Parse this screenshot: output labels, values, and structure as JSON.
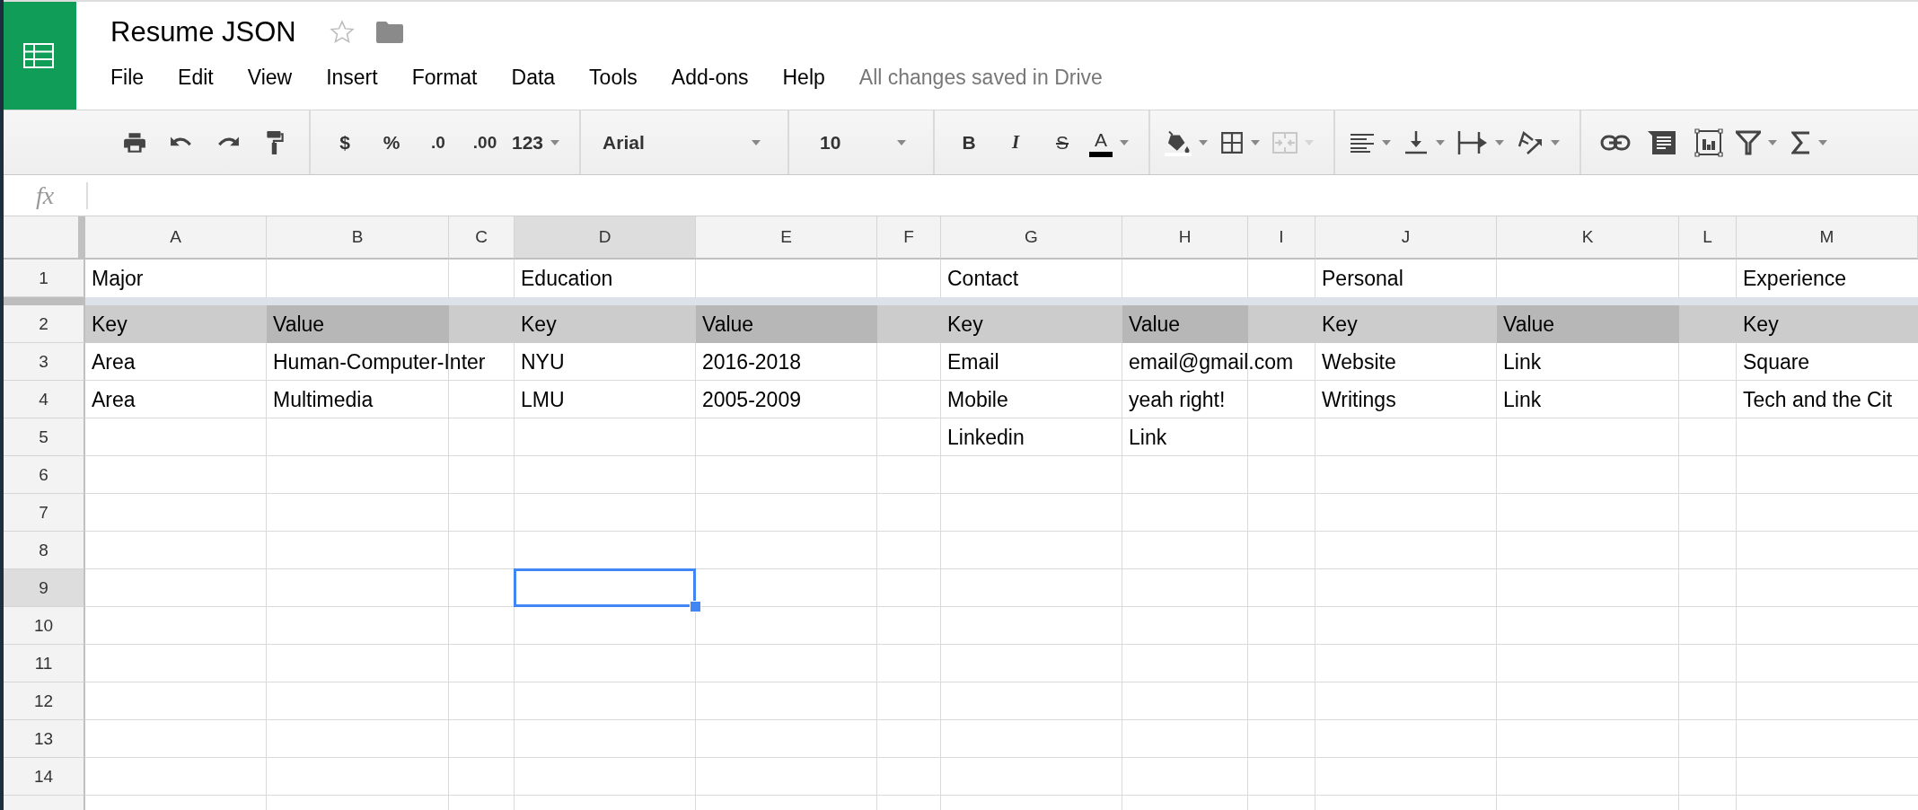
{
  "document": {
    "title": "Resume JSON",
    "starred": false
  },
  "menu": [
    {
      "label": "File"
    },
    {
      "label": "Edit"
    },
    {
      "label": "View"
    },
    {
      "label": "Insert"
    },
    {
      "label": "Format"
    },
    {
      "label": "Data"
    },
    {
      "label": "Tools"
    },
    {
      "label": "Add-ons"
    },
    {
      "label": "Help"
    }
  ],
  "save_status": "All changes saved in Drive",
  "toolbar": {
    "currency": "$",
    "percent": "%",
    "decrease_decimals": ".0",
    "increase_decimals": ".00",
    "number_format": "123",
    "font": "Arial",
    "font_size": "10",
    "bold": "B",
    "italic": "I",
    "strikethrough": "S",
    "text_color": "A",
    "merge_disabled": true
  },
  "formula_bar": {
    "label": "fx"
  },
  "columns": [
    {
      "label": "A",
      "selected": false
    },
    {
      "label": "B",
      "selected": false
    },
    {
      "label": "C",
      "selected": false
    },
    {
      "label": "D",
      "selected": true
    },
    {
      "label": "E",
      "selected": false
    },
    {
      "label": "F",
      "selected": false
    },
    {
      "label": "G",
      "selected": false
    },
    {
      "label": "H",
      "selected": false
    },
    {
      "label": "I",
      "selected": false
    },
    {
      "label": "J",
      "selected": false
    },
    {
      "label": "K",
      "selected": false
    },
    {
      "label": "L",
      "selected": false
    },
    {
      "label": "M",
      "selected": false
    }
  ],
  "rows": [
    {
      "number": "1",
      "selected": false,
      "cells": [
        "Major",
        null,
        null,
        "Education",
        null,
        null,
        "Contact",
        null,
        null,
        "Personal",
        null,
        null,
        "Experience"
      ]
    },
    {
      "number": "2",
      "selected": false,
      "cells": [
        {
          "text": "Key",
          "color": "#cccccc"
        },
        {
          "text": "Value",
          "color": "#b7b7b7"
        },
        {
          "color": "#cccccc"
        },
        {
          "text": "Key",
          "color": "#cccccc"
        },
        {
          "text": "Value",
          "color": "#b7b7b7"
        },
        {
          "color": "#cccccc"
        },
        {
          "text": "Key",
          "color": "#cccccc"
        },
        {
          "text": "Value",
          "color": "#b7b7b7"
        },
        {
          "color": "#cccccc"
        },
        {
          "text": "Key",
          "color": "#cccccc"
        },
        {
          "text": "Value",
          "color": "#b7b7b7"
        },
        {
          "color": "#cccccc"
        },
        {
          "text": "Key",
          "color": "#cccccc"
        }
      ]
    },
    {
      "number": "3",
      "selected": false,
      "cells": [
        "Area",
        "Human-Computer-Inter",
        null,
        "NYU",
        "2016-2018",
        null,
        "Email",
        "email@gmail.com",
        null,
        "Website",
        "Link",
        null,
        "Square"
      ]
    },
    {
      "number": "4",
      "selected": false,
      "cells": [
        "Area",
        "Multimedia",
        null,
        "LMU",
        "2005-2009",
        null,
        "Mobile",
        "yeah right!",
        null,
        "Writings",
        "Link",
        null,
        "Tech and the Cit"
      ]
    },
    {
      "number": "5",
      "selected": false,
      "cells": [
        null,
        null,
        null,
        null,
        null,
        null,
        "Linkedin",
        "Link",
        null,
        null,
        null,
        null,
        null
      ]
    },
    {
      "number": "6",
      "selected": false,
      "cells": []
    },
    {
      "number": "7",
      "selected": false,
      "cells": []
    },
    {
      "number": "8",
      "selected": false,
      "cells": []
    },
    {
      "number": "9",
      "selected": true,
      "cells": []
    },
    {
      "number": "10",
      "selected": false,
      "cells": []
    },
    {
      "number": "11",
      "selected": false,
      "cells": []
    },
    {
      "number": "12",
      "selected": false,
      "cells": []
    },
    {
      "number": "13",
      "selected": false,
      "cells": []
    },
    {
      "number": "14",
      "selected": false,
      "cells": []
    }
  ]
}
